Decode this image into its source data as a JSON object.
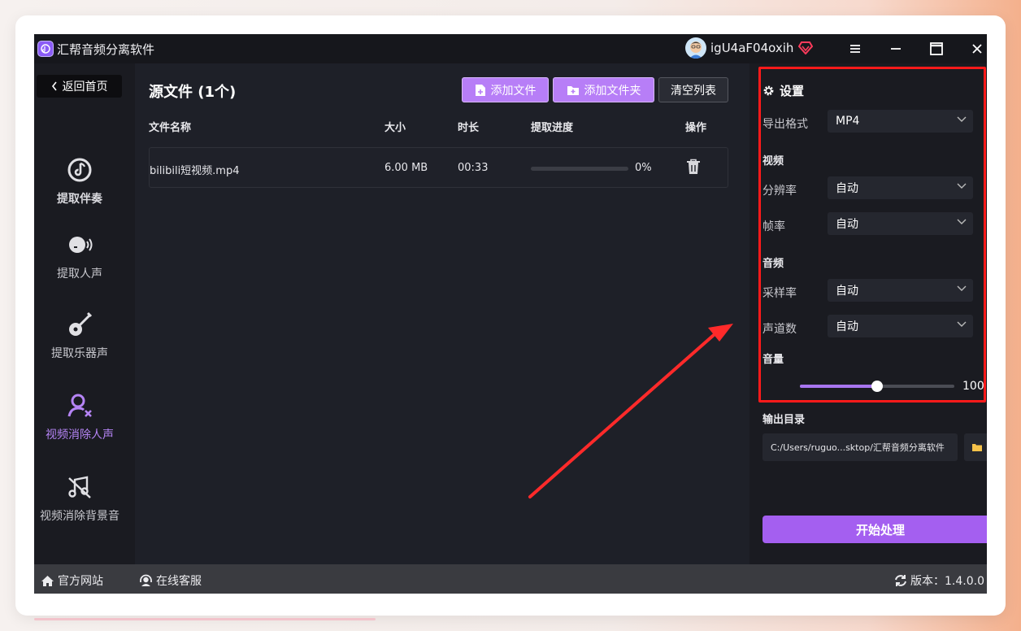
{
  "titlebar": {
    "app_title": "汇帮音频分离软件",
    "username": "igU4aF04oxih"
  },
  "sidebar": {
    "back_label": "返回首页",
    "items": [
      {
        "label": "提取伴奏",
        "icon": "music-note-icon"
      },
      {
        "label": "提取人声",
        "icon": "voice-icon"
      },
      {
        "label": "提取乐器声",
        "icon": "guitar-icon"
      },
      {
        "label": "视频消除人声",
        "icon": "user-remove-icon"
      },
      {
        "label": "视频消除背景音",
        "icon": "music-off-icon"
      }
    ]
  },
  "main": {
    "title": "源文件 (1个)",
    "add_file_label": "添加文件",
    "add_folder_label": "添加文件夹",
    "clear_label": "清空列表",
    "columns": [
      "文件名称",
      "大小",
      "时长",
      "提取进度",
      "操作"
    ],
    "rows": [
      {
        "name": "bilibili短视频.mp4",
        "size": "6.00 MB",
        "duration": "00:33",
        "progress_text": "0%",
        "progress": 0
      }
    ]
  },
  "settings": {
    "title": "设置",
    "export_format_label": "导出格式",
    "export_format_value": "MP4",
    "video_section": "视频",
    "resolution_label": "分辨率",
    "resolution_value": "自动",
    "framerate_label": "帧率",
    "framerate_value": "自动",
    "audio_section": "音频",
    "samplerate_label": "采样率",
    "samplerate_value": "自动",
    "channels_label": "声道数",
    "channels_value": "自动",
    "volume_label": "音量",
    "volume_value": "100",
    "volume_fraction": 0.5,
    "output_dir_label": "输出目录",
    "output_dir_value": "C:/Users/ruguo...sktop/汇帮音频分离软件",
    "start_label": "开始处理"
  },
  "statusbar": {
    "website_label": "官方网站",
    "support_label": "在线客服",
    "version_label": "版本：1.4.0.0"
  },
  "colors": {
    "accent": "#b77ef7",
    "start_button": "#a45ff0",
    "highlight": "#ff1a1a"
  }
}
